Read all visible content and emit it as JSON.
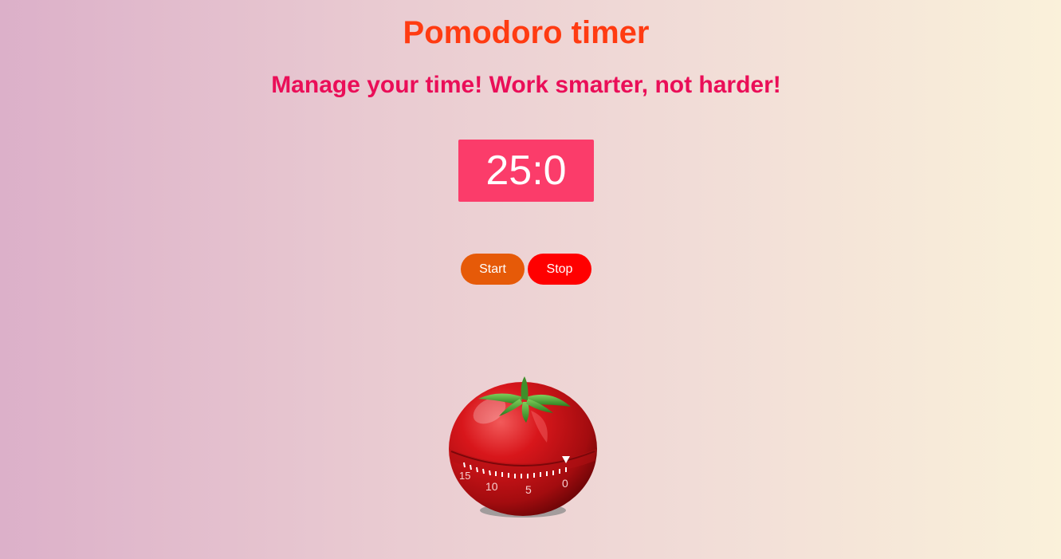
{
  "header": {
    "title": "Pomodoro timer",
    "subtitle": "Manage your time! Work smarter, not harder!"
  },
  "timer": {
    "display": "25:0"
  },
  "controls": {
    "start_label": "Start",
    "stop_label": "Stop"
  },
  "illustration": {
    "icon": "tomato-timer-icon",
    "dial_labels": [
      "15",
      "10",
      "5",
      "0"
    ]
  },
  "colors": {
    "title": "#ff3b12",
    "subtitle": "#ea0e58",
    "timer_bg": "#fb3c6a",
    "start_bg": "#e65a08",
    "stop_bg": "#ff0000"
  }
}
